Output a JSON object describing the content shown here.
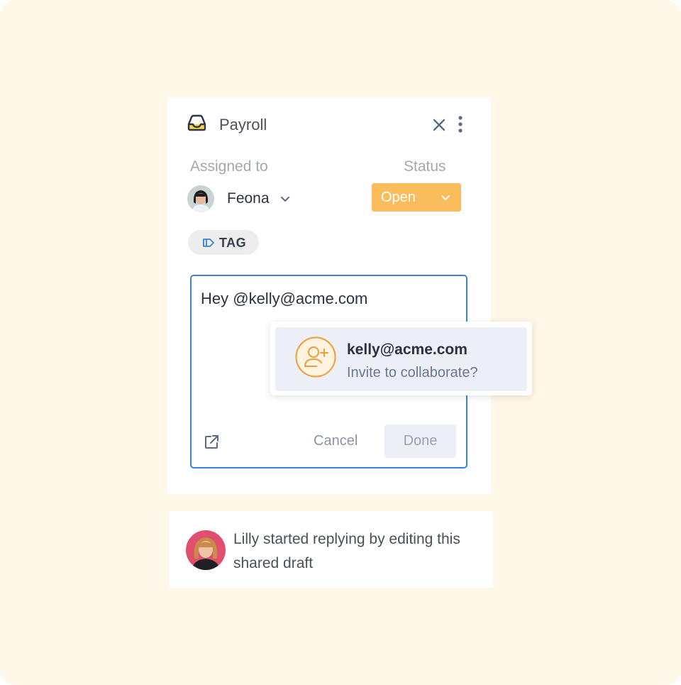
{
  "header": {
    "title": "Payroll",
    "icon": "inbox-icon",
    "close_icon": "close-icon",
    "more_icon": "more-vertical-icon"
  },
  "assignment": {
    "assigned_label": "Assigned to",
    "assignee_name": "Feona",
    "status_label": "Status",
    "status_value": "Open",
    "status_color": "#fbbd5c"
  },
  "tag": {
    "label": "TAG"
  },
  "editor": {
    "text": "Hey @kelly@acme.com",
    "cancel_label": "Cancel",
    "done_label": "Done"
  },
  "mention_popup": {
    "email": "kelly@acme.com",
    "subtitle": "Invite to collaborate?"
  },
  "activity": {
    "message": "Lilly started replying by editing this shared draft"
  },
  "colors": {
    "background": "#fff7e8",
    "accent_blue": "#3b82d6",
    "accent_orange": "#f39a3c"
  }
}
